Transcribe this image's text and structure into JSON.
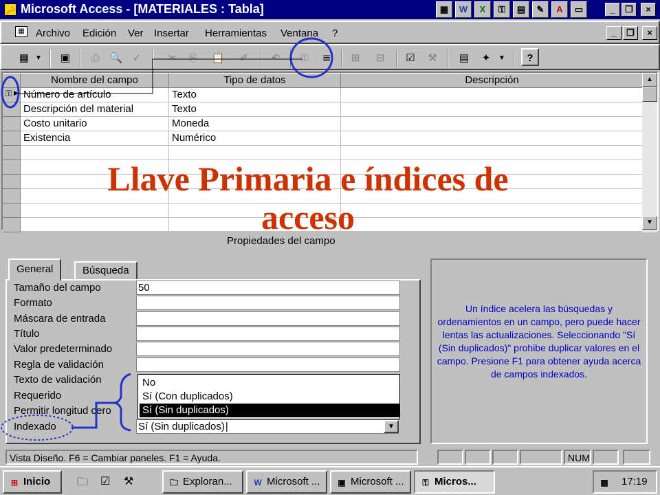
{
  "window": {
    "title": "Microsoft Access - [MATERIALES : Tabla]",
    "title_buttons": [
      "_",
      "□",
      "×"
    ]
  },
  "menu": {
    "items": [
      "Archivo",
      "Edición",
      "Ver",
      "Insertar",
      "Herramientas",
      "Ventana",
      "?"
    ]
  },
  "grid": {
    "headers": [
      "Nombre del campo",
      "Tipo de datos",
      "Descripción"
    ],
    "rows": [
      {
        "name": "Número de artículo",
        "type": "Texto",
        "desc": ""
      },
      {
        "name": "Descripción del material",
        "type": "Texto",
        "desc": ""
      },
      {
        "name": "Costo unitario",
        "type": "Moneda",
        "desc": ""
      },
      {
        "name": "Existencia",
        "type": "Numérico",
        "desc": ""
      }
    ]
  },
  "overlay": {
    "title": "Llave Primaria e índices de acceso"
  },
  "properties": {
    "section_title": "Propiedades del campo",
    "tabs": [
      "General",
      "Búsqueda"
    ],
    "fields": [
      {
        "label": "Tamaño del campo",
        "value": "50"
      },
      {
        "label": "Formato",
        "value": ""
      },
      {
        "label": "Máscara de entrada",
        "value": ""
      },
      {
        "label": "Título",
        "value": ""
      },
      {
        "label": "Valor predeterminado",
        "value": ""
      },
      {
        "label": "Regla de validación",
        "value": ""
      },
      {
        "label": "Texto de validación",
        "value": ""
      },
      {
        "label": "Requerido",
        "value": ""
      },
      {
        "label": "Permitir longitud cero",
        "value": ""
      },
      {
        "label": "Indexado",
        "value": "Sí (Sin duplicados)"
      }
    ],
    "dropdown_options": [
      "No",
      "Sí (Con duplicados)",
      "Sí (Sin duplicados)"
    ],
    "dropdown_selected": "Sí (Sin duplicados)"
  },
  "help": {
    "text": "Un índice acelera las búsquedas y ordenamientos en un campo, pero puede hacer lentas las actualizaciones. Seleccionando \"Sí (Sin duplicados)\" prohibe duplicar valores en el campo. Presione F1 para obtener ayuda acerca de campos indexados."
  },
  "status": {
    "text": "Vista Diseño.  F6 = Cambiar paneles.  F1 = Ayuda.",
    "num": "NUM"
  },
  "taskbar": {
    "start": "Inicio",
    "buttons": [
      "Exploran...",
      "Microsoft ...",
      "Microsoft ...",
      "Micros..."
    ],
    "clock": "17:19"
  },
  "colors": {
    "title_bg": "#000080",
    "overlay_text": "#cc3300",
    "help_text": "#0000c0",
    "annotation": "#2233cc"
  }
}
